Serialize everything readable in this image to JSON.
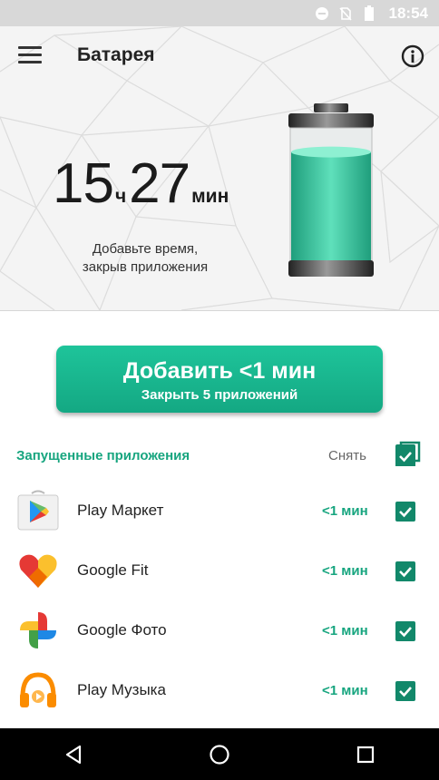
{
  "status_bar": {
    "time": "18:54",
    "icons": [
      "do-not-disturb-icon",
      "no-sim-icon",
      "battery-icon"
    ]
  },
  "header": {
    "title": "Батарея",
    "menu_icon": "hamburger-menu-icon",
    "info_icon": "info-icon"
  },
  "summary": {
    "hours": "15",
    "hours_unit": "ч",
    "minutes": "27",
    "minutes_unit": "мин",
    "hint_line1": "Добавьте время,",
    "hint_line2": "закрыв приложения",
    "battery_level": 0.82
  },
  "boost_button": {
    "label": "Добавить <1 мин",
    "sublabel": "Закрыть 5 приложений"
  },
  "running_apps": {
    "title": "Запущенные приложения",
    "clear_label": "Снять",
    "items": [
      {
        "name": "Play Маркет",
        "gain": "<1 мин",
        "icon": "play-store-icon",
        "checked": true
      },
      {
        "name": "Google Fit",
        "gain": "<1 мин",
        "icon": "google-fit-icon",
        "checked": true
      },
      {
        "name": "Google Фото",
        "gain": "<1 мин",
        "icon": "google-photos-icon",
        "checked": true
      },
      {
        "name": "Play Музыка",
        "gain": "<1 мин",
        "icon": "play-music-icon",
        "checked": true
      }
    ]
  },
  "colors": {
    "accent": "#17a57f",
    "button": "#1ec49a",
    "checkbox": "#12886a",
    "battery_fill": "#3ecfa6"
  }
}
